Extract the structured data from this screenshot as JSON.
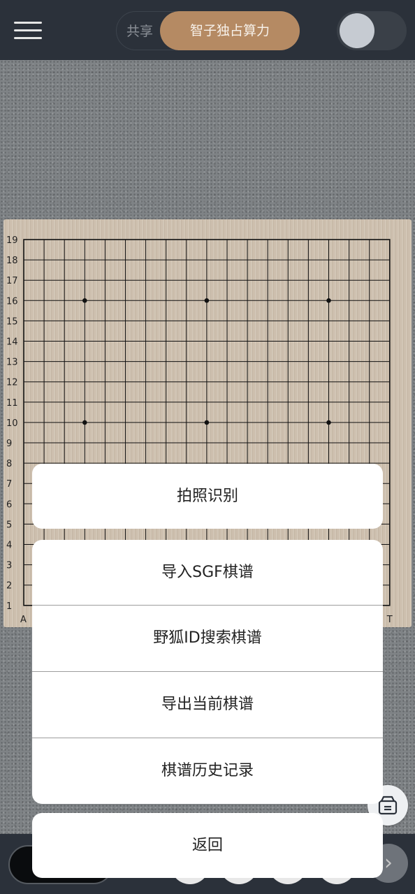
{
  "topbar": {
    "share_label": "共享",
    "exclusive_label": "智子独占算力"
  },
  "board": {
    "size": 19,
    "row_labels": [
      "19",
      "18",
      "17",
      "16",
      "15",
      "14",
      "13",
      "12",
      "11",
      "10",
      "9",
      "8",
      "7",
      "6",
      "5",
      "4",
      "3",
      "2",
      "1"
    ],
    "column_labels_visible": [
      "A",
      "T"
    ],
    "star_points": [
      [
        4,
        16
      ],
      [
        10,
        16
      ],
      [
        16,
        16
      ],
      [
        4,
        10
      ],
      [
        10,
        10
      ],
      [
        16,
        10
      ]
    ]
  },
  "actions": {
    "photo": "拍照识别",
    "import_sgf": "导入SGF棋谱",
    "foxy_search": "野狐ID搜索棋谱",
    "export": "导出当前棋谱",
    "history": "棋谱历史记录",
    "back": "返回"
  },
  "colors": {
    "accent": "#b58a63",
    "topbar": "#2b313a",
    "board": "#cdbfae"
  },
  "icons": {
    "menu": "menu-icon",
    "archive": "archive-box-icon",
    "next": "chevron-right-icon"
  }
}
